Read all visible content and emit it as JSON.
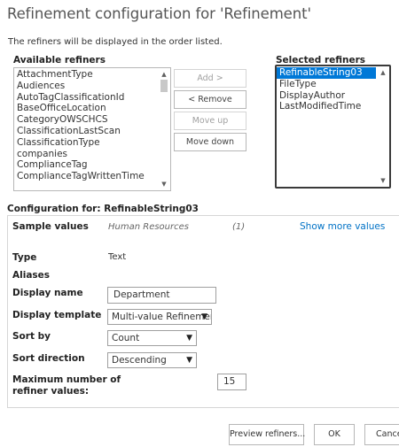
{
  "header": {
    "title": "Refinement configuration for 'Refinement'",
    "subtitle": "The refiners will be displayed in the order listed."
  },
  "available": {
    "label": "Available refiners",
    "items": [
      "AttachmentType",
      "Audiences",
      "AutoTagClassificationId",
      "BaseOfficeLocation",
      "CategoryOWSCHCS",
      "ClassificationLastScan",
      "ClassificationType",
      "companies",
      "ComplianceTag",
      "ComplianceTagWrittenTime"
    ]
  },
  "actions": {
    "add": "Add >",
    "remove": "< Remove",
    "move_up": "Move up",
    "move_down": "Move down"
  },
  "selected": {
    "label": "Selected refiners",
    "items": [
      "RefinableString03",
      "FileType",
      "DisplayAuthor",
      "LastModifiedTime"
    ],
    "selected_index": 0
  },
  "config": {
    "heading": "Configuration for: RefinableString03",
    "sample_values_label": "Sample values",
    "sample_value": "Human Resources",
    "sample_count": "(1)",
    "show_more": "Show more values",
    "type_label": "Type",
    "type_value": "Text",
    "aliases_label": "Aliases",
    "display_name_label": "Display name",
    "display_name_value": "Department",
    "display_template_label": "Display template",
    "display_template_value": "Multi-value Refinement Item",
    "sort_by_label": "Sort by",
    "sort_by_value": "Count",
    "sort_direction_label": "Sort direction",
    "sort_direction_value": "Descending",
    "max_values_label_1": "Maximum number of",
    "max_values_label_2": "refiner values:",
    "max_values_value": "15"
  },
  "footer": {
    "preview": "Preview refiners...",
    "ok": "OK",
    "cancel": "Cancel"
  },
  "colors": {
    "selection": "#0078d7",
    "link": "#0072c6",
    "title": "#555555"
  }
}
